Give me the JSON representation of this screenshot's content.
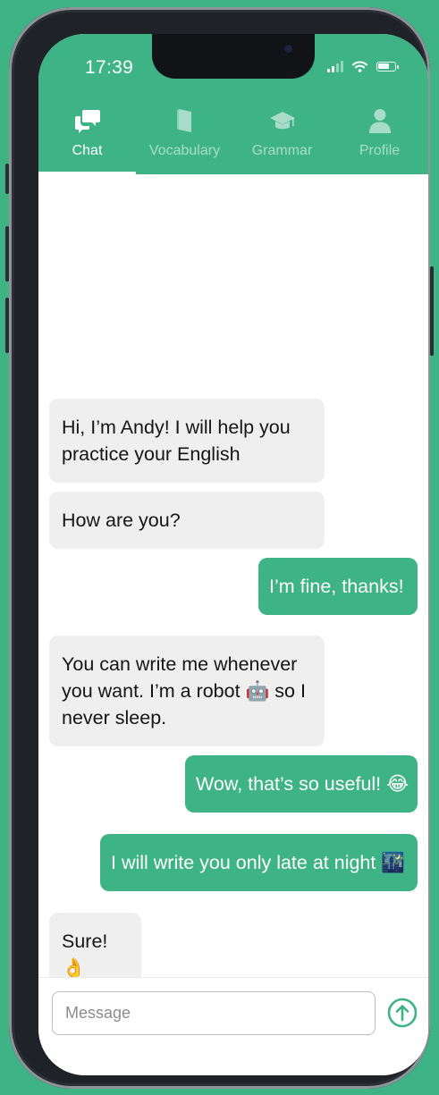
{
  "status_bar": {
    "time": "17:39"
  },
  "tabs": [
    {
      "label": "Chat",
      "icon": "chat-bubbles-icon",
      "active": true
    },
    {
      "label": "Vocabulary",
      "icon": "book-icon",
      "active": false
    },
    {
      "label": "Grammar",
      "icon": "graduation-cap-icon",
      "active": false
    },
    {
      "label": "Profile",
      "icon": "person-icon",
      "active": false
    }
  ],
  "messages": [
    {
      "from": "bot",
      "text": "Hi, I’m Andy! I will help you practice your English"
    },
    {
      "from": "bot",
      "text": "How are you?"
    },
    {
      "from": "user",
      "text": "I’m fine, thanks!"
    },
    {
      "from": "bot",
      "text": "You can write me whenever you want. I’m a robot 🤖 so I never sleep."
    },
    {
      "from": "user",
      "text": "Wow, that’s so useful! 😂"
    },
    {
      "from": "user",
      "text": "I will write you only late at night 🌃"
    },
    {
      "from": "bot",
      "text": "Sure! 👌"
    }
  ],
  "composer": {
    "placeholder": "Message",
    "value": "",
    "send_icon": "arrow-up-circle-icon"
  },
  "colors": {
    "accent": "#3db386",
    "bot_bubble": "#efefef",
    "phone_frame": "#1f2226"
  }
}
